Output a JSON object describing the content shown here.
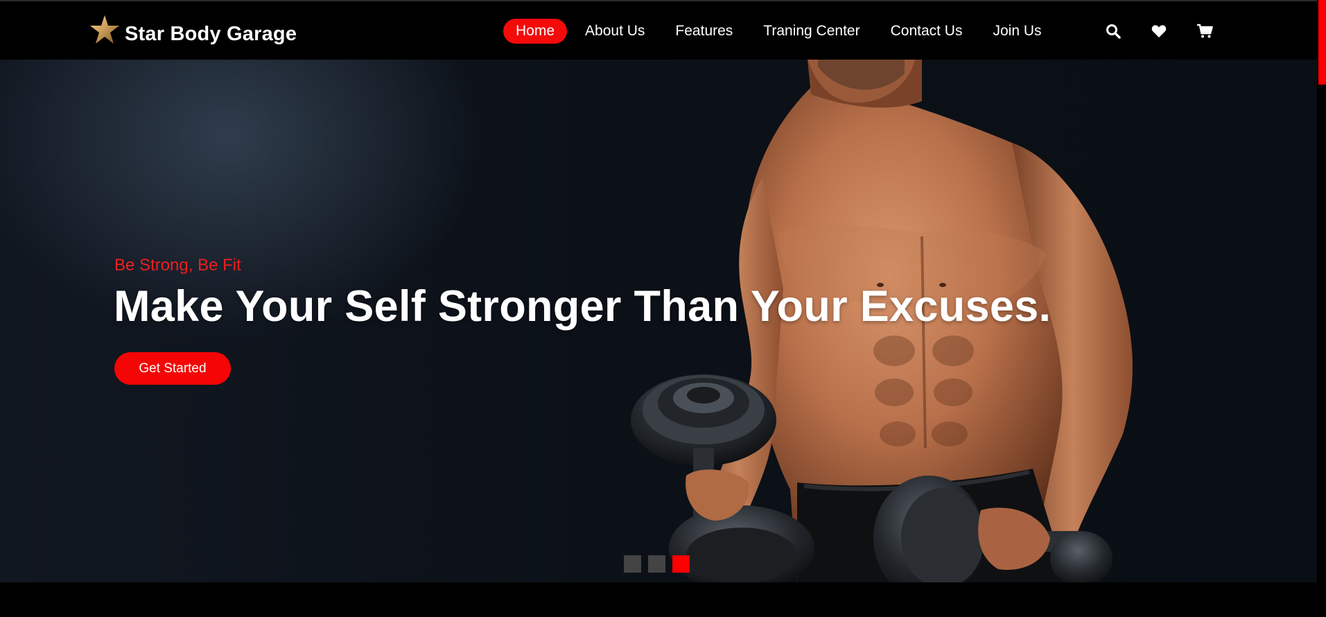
{
  "header": {
    "brand": "Star Body Garage",
    "nav": [
      {
        "label": "Home",
        "active": true
      },
      {
        "label": "About Us",
        "active": false
      },
      {
        "label": "Features",
        "active": false
      },
      {
        "label": "Traning Center",
        "active": false
      },
      {
        "label": "Contact Us",
        "active": false
      },
      {
        "label": "Join Us",
        "active": false
      }
    ],
    "icons": [
      "search-icon",
      "heart-icon",
      "cart-icon"
    ]
  },
  "hero": {
    "tagline": "Be Strong, Be Fit",
    "headline": "Make Your Self Stronger Than Your Excuses.",
    "cta_label": "Get Started",
    "slides_total": 3,
    "active_slide": 3
  },
  "colors": {
    "accent": "#f50a0a",
    "background": "#000000",
    "text": "#ffffff"
  }
}
